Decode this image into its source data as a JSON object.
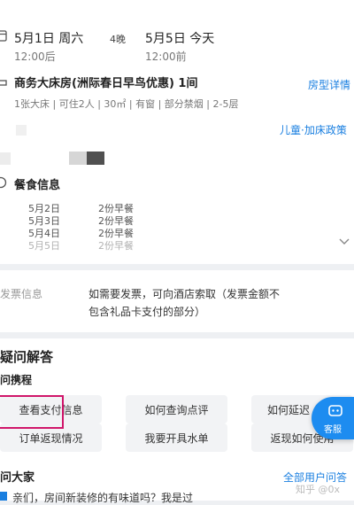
{
  "stay": {
    "checkin_date": "5月1日 周六",
    "nights": "4晚",
    "checkout_date": "5月5日 今天",
    "checkin_time": "12:00后",
    "checkout_time": "12:00前"
  },
  "room": {
    "title": "商务大床房(洲际春日早鸟优惠) 1间",
    "details_link": "房型详情",
    "specs": "1张大床 | 可住2人 | 30㎡ | 有窗 | 部分禁烟 | 2-5层",
    "policy_link": "儿童·加床政策"
  },
  "meals": {
    "title": "餐食信息",
    "rows": [
      {
        "date": "5月2日",
        "meal": "2份早餐"
      },
      {
        "date": "5月3日",
        "meal": "2份早餐"
      },
      {
        "date": "5月4日",
        "meal": "2份早餐"
      },
      {
        "date": "5月5日",
        "meal": "2份早餐"
      }
    ]
  },
  "invoice": {
    "label": "发票信息",
    "text_line1": "如需要发票，可向酒店索取（发票金额不",
    "text_line2": "包含礼品卡支付的部分）"
  },
  "faq": {
    "title": "疑问解答",
    "subtitle": "问携程",
    "questions": [
      "查看支付信息",
      "如何查询点评",
      "如何延迟",
      "订单返现情况",
      "我要开具水单",
      "返现如何使用"
    ],
    "service_label": "客服"
  },
  "community": {
    "title": "问大家",
    "all_link": "全部用户问答",
    "preview": "亲们，房间新装修的有味道吗？我是过"
  },
  "watermark": "知乎 @0x",
  "colors": {
    "accent": "#1a7fe0",
    "highlight": "#d0166a",
    "service_button": "#1d8cf0"
  }
}
